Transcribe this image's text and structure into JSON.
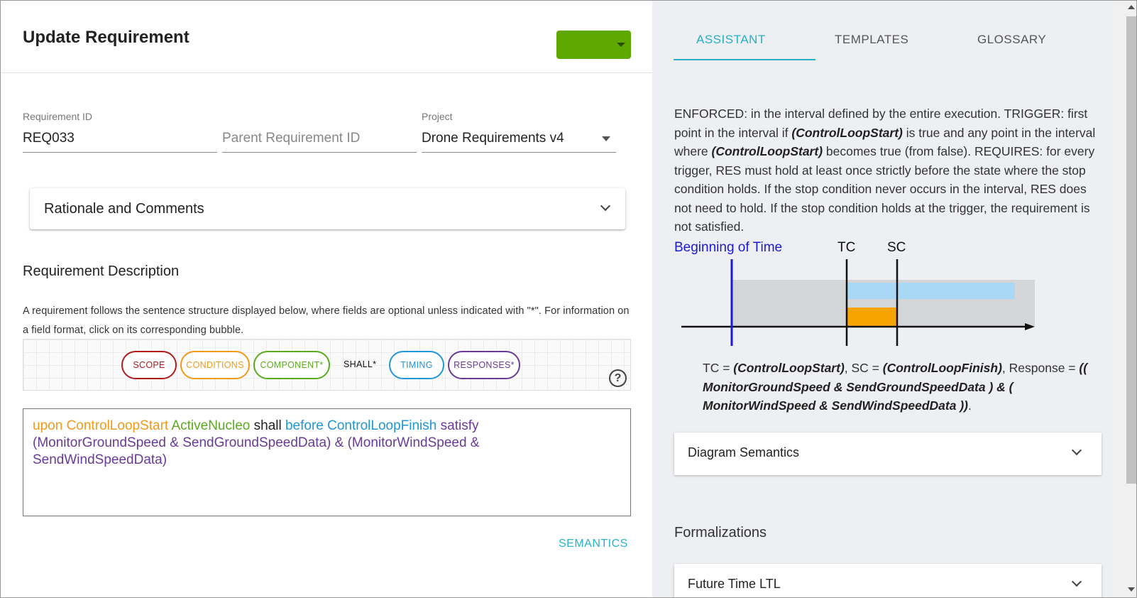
{
  "dialog": {
    "title": "Update Requirement",
    "save_button_label": ""
  },
  "fields": {
    "req_id": {
      "label": "Requirement ID",
      "value": "REQ033"
    },
    "parent_id": {
      "placeholder": "Parent Requirement ID"
    },
    "project": {
      "label": "Project",
      "value": "Drone Requirements v4"
    }
  },
  "rationale": {
    "label": "Rationale and Comments"
  },
  "description": {
    "title": "Requirement Description",
    "help": "A requirement follows the sentence structure displayed below, where fields are optional unless indicated with \"*\". For information on a field format, click on its corresponding bubble."
  },
  "bubbles": {
    "scope": "SCOPE",
    "conditions": "CONDITIONS",
    "component": "COMPONENT*",
    "shall": "SHALL*",
    "timing": "TIMING",
    "responses": "RESPONSES*"
  },
  "help_icon": "?",
  "requirement_text": {
    "upon": "upon",
    "condition": "ControlLoopStart",
    "component": "ActiveNucleo",
    "shall": "shall",
    "timing": "before ControlLoopFinish",
    "response": "satisfy (MonitorGroundSpeed & SendGroundSpeedData) & (MonitorWindSpeed & SendWindSpeedData)"
  },
  "semantics_link": "SEMANTICS",
  "tabs": {
    "assistant": "ASSISTANT",
    "templates": "TEMPLATES",
    "glossary": "GLOSSARY"
  },
  "explanation": {
    "p1": "ENFORCED: in the interval defined by the entire execution. TRIGGER: first point in the interval if ",
    "cond1": "(ControlLoopStart)",
    "p2": " is true and any point in the interval where ",
    "cond2": "(ControlLoopStart)",
    "p3": " becomes true (from false). REQUIRES: for every trigger, RES must hold at least once strictly before the state where the stop condition holds. If the stop condition never occurs in the interval, RES does not need to hold. If the stop condition holds at the trigger, the requirement is not satisfied."
  },
  "diagram": {
    "beginning_label": "Beginning of Time",
    "tc_label": "TC",
    "sc_label": "SC"
  },
  "formula": {
    "tc_prefix": "TC = ",
    "tc": "(ControlLoopStart)",
    "sc_prefix": ", SC = ",
    "sc": "(ControlLoopFinish)",
    "resp_prefix": ", Response = ",
    "resp": "(( MonitorGroundSpeed & SendGroundSpeedData ) & ( MonitorWindSpeed & SendWindSpeedData ))",
    "suffix": "."
  },
  "cards": {
    "diagram_semantics": "Diagram Semantics",
    "future_time": "Future Time LTL"
  },
  "formalizations_title": "Formalizations",
  "colors": {
    "save": "#5fa800",
    "accent": "#26b0c4",
    "scope": "#b01c1c",
    "conditions": "#f19a1a",
    "component": "#5aab1e",
    "timing": "#2196d8",
    "responses": "#6a3a98"
  }
}
